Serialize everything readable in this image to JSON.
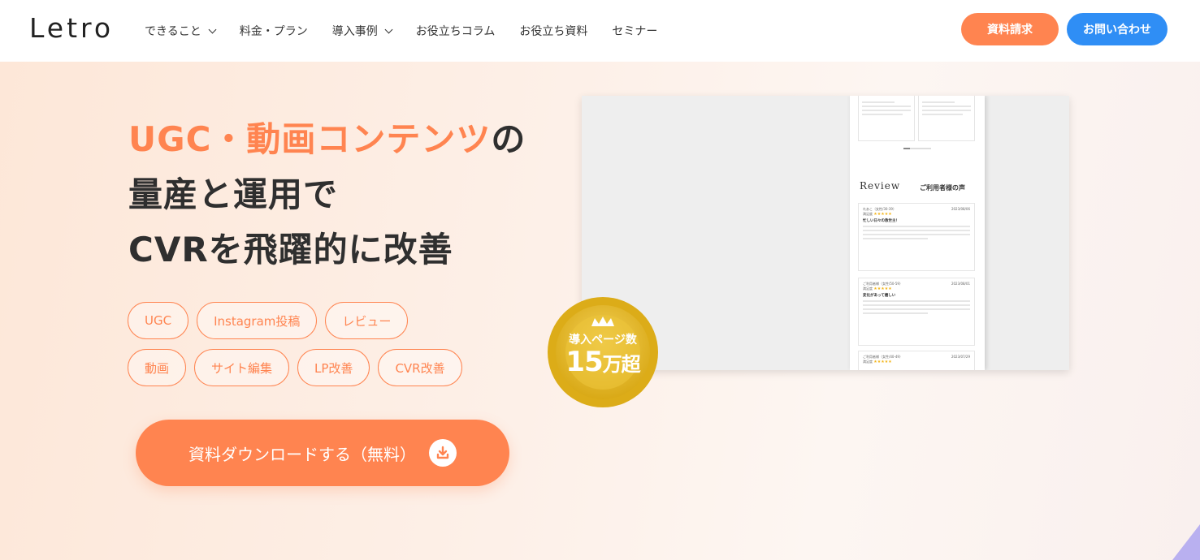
{
  "brand": {
    "logo": "Letro",
    "accent": "#ff8450",
    "blue": "#2f8ef5"
  },
  "nav": {
    "items": [
      {
        "label": "できること",
        "dropdown": true
      },
      {
        "label": "料金・プラン",
        "dropdown": false
      },
      {
        "label": "導入事例",
        "dropdown": true
      },
      {
        "label": "お役立ちコラム",
        "dropdown": false
      },
      {
        "label": "お役立ち資料",
        "dropdown": false
      },
      {
        "label": "セミナー",
        "dropdown": false
      }
    ],
    "doc_button": "資料請求",
    "contact_button": "お問い合わせ"
  },
  "hero": {
    "headline_accent": "UGC・動画コンテンツ",
    "headline_line1_rest": "の",
    "headline_line2": "量産と運用で",
    "headline_line3": "CVRを飛躍的に改善",
    "tags_row1": [
      "UGC",
      "Instagram投稿",
      "レビュー"
    ],
    "tags_row2": [
      "動画",
      "サイト編集",
      "LP改善",
      "CVR改善"
    ],
    "cta_label": "資料ダウンロードする（無料）"
  },
  "mockup": {
    "review_title": "Review",
    "review_subtitle": "ご利用者様の声",
    "reviews": [
      {
        "user": "れあこ（女性/30-39）",
        "date": "2023/08/06",
        "label": "満足度",
        "stars": "★★★★★",
        "heading": "忙しい日々の救世主！"
      },
      {
        "user": "ご利用者様（女性/50-59）",
        "date": "2023/08/01",
        "label": "満足度",
        "stars": "★★★★★",
        "heading": "変化があって嬉しい"
      },
      {
        "user": "ご利用者様（女性/40-49）",
        "date": "2023/07/29",
        "label": "満足度",
        "stars": "★★★★★",
        "heading": ""
      }
    ]
  },
  "badge": {
    "top": "導入ページ数",
    "number": "15",
    "suffix": "万超"
  }
}
